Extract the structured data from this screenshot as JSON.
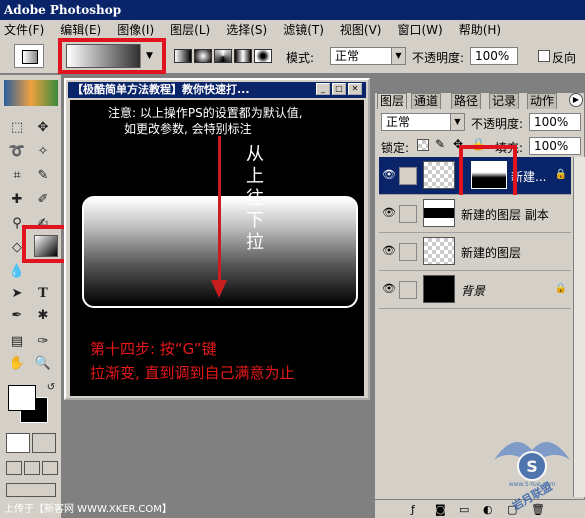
{
  "app": {
    "title": "Adobe Photoshop"
  },
  "menu": [
    "文件(F)",
    "编辑(E)",
    "图像(I)",
    "图层(L)",
    "选择(S)",
    "滤镜(T)",
    "视图(V)",
    "窗口(W)",
    "帮助(H)"
  ],
  "options": {
    "mode_label": "模式:",
    "mode_value": "正常",
    "opacity_label": "不透明度:",
    "opacity_value": "100%",
    "reverse_label": "反向"
  },
  "document": {
    "title": "【极酷简单方法教程】教你快速打...",
    "note_line1": "注意: 以上操作PS的设置都为默认值,",
    "note_line2": "如更改参数, 会特别标注",
    "vertical_text": [
      "从",
      "上",
      "往",
      "下",
      "拉"
    ],
    "step_line1": "第十四步: 按“G”键",
    "step_line2": "拉渐变, 直到调到自己满意为止"
  },
  "layers_panel": {
    "tabs": [
      "图层",
      "通道",
      "路径",
      "记录",
      "动作"
    ],
    "blend_mode": "正常",
    "opacity_label": "不透明度:",
    "opacity_value": "100%",
    "lock_label": "锁定:",
    "fill_label": "填充:",
    "fill_value": "100%",
    "layers": [
      {
        "name": "新建...",
        "selected": true
      },
      {
        "name": "新建的图层 副本",
        "selected": false
      },
      {
        "name": "新建的图层",
        "selected": false
      },
      {
        "name": "背景",
        "selected": false
      }
    ]
  },
  "watermark": {
    "bottom_left": "上传于【新客网 WWW.XKER.COM】",
    "logo_text": "岩月联盟",
    "logo_url": "www.S-Yue.com"
  },
  "colors": {
    "highlight_red": "#e0141e",
    "title_blue": "#0a246a",
    "step_red": "#e61919"
  }
}
